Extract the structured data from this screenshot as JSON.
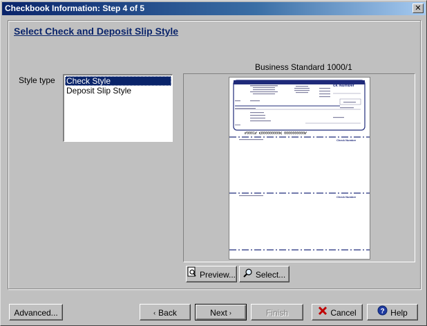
{
  "window": {
    "title": "Checkbook Information: Step 4 of 5",
    "close_label": "✕"
  },
  "heading": "Select Check and Deposit Slip Style",
  "style_type": {
    "label": "Style type",
    "items": [
      {
        "label": "Check Style",
        "selected": true
      },
      {
        "label": "Deposit Slip Style",
        "selected": false
      }
    ]
  },
  "preview": {
    "title": "Business Standard 1000/1",
    "check_number_label": "ck Number",
    "stub_label": "Check Number",
    "micr_line": "⑈0001⑈ ⑆000000000⑆ 0000000000⑈"
  },
  "buttons": {
    "preview": "Preview...",
    "select": "Select...",
    "advanced": "Advanced...",
    "back": "Back",
    "next": "Next",
    "finish": "Finish",
    "cancel": "Cancel",
    "help": "Help"
  },
  "colors": {
    "accent": "#0a246a",
    "check_border": "#1f2a7a"
  }
}
